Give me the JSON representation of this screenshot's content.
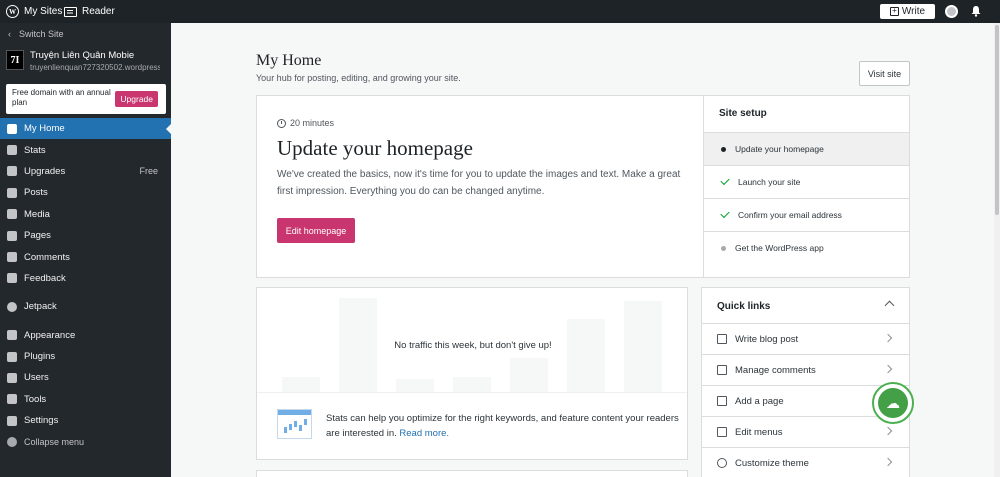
{
  "masterbar": {
    "my_sites": "My Sites",
    "reader": "Reader",
    "write": "Write"
  },
  "sidebar": {
    "switch_site": "Switch Site",
    "site_name": "Truyện Liên Quân Mobie",
    "site_url": "truyenlienquan727320502.wordpress.com",
    "site_icon_text": "7I",
    "upsell_text": "Free domain with an annual plan",
    "upsell_button": "Upgrade",
    "items": [
      {
        "label": "My Home",
        "icon": "home-icon"
      },
      {
        "label": "Stats",
        "icon": "stats-icon"
      },
      {
        "label": "Upgrades",
        "icon": "upgrades-icon",
        "badge": "Free"
      },
      {
        "label": "Posts",
        "icon": "posts-icon"
      },
      {
        "label": "Media",
        "icon": "media-icon"
      },
      {
        "label": "Pages",
        "icon": "pages-icon"
      },
      {
        "label": "Comments",
        "icon": "comments-icon"
      },
      {
        "label": "Feedback",
        "icon": "feedback-icon"
      },
      {
        "label": "Jetpack",
        "icon": "jetpack-icon"
      },
      {
        "label": "Appearance",
        "icon": "appearance-icon"
      },
      {
        "label": "Plugins",
        "icon": "plugins-icon"
      },
      {
        "label": "Users",
        "icon": "users-icon"
      },
      {
        "label": "Tools",
        "icon": "tools-icon"
      },
      {
        "label": "Settings",
        "icon": "settings-icon"
      }
    ],
    "collapse": "Collapse menu"
  },
  "main": {
    "title": "My Home",
    "subtitle": "Your hub for posting, editing, and growing your site.",
    "visit_site": "Visit site"
  },
  "hero": {
    "time": "20 minutes",
    "title": "Update your homepage",
    "text": "We've created the basics, now it's time for you to update the images and text. Make a great first impression. Everything you do can be changed anytime.",
    "button": "Edit homepage"
  },
  "setup": {
    "title": "Site setup",
    "items": [
      {
        "label": "Update your homepage",
        "state": "current"
      },
      {
        "label": "Launch your site",
        "state": "done"
      },
      {
        "label": "Confirm your email address",
        "state": "done"
      },
      {
        "label": "Get the WordPress app",
        "state": "todo"
      }
    ]
  },
  "stats": {
    "empty": "No traffic this week, but don't give up!",
    "text": "Stats can help you optimize for the right keywords, and feature content your readers are interested in.",
    "link": "Read more."
  },
  "quick_links": {
    "title": "Quick links",
    "items": [
      {
        "label": "Write blog post",
        "icon": "pencil-icon"
      },
      {
        "label": "Manage comments",
        "icon": "comment-icon"
      },
      {
        "label": "Add a page",
        "icon": "page-icon"
      },
      {
        "label": "Edit menus",
        "icon": "menu-icon"
      },
      {
        "label": "Customize theme",
        "icon": "palette-icon"
      }
    ]
  },
  "colors": {
    "accent": "#c9356e",
    "active": "#2271b1",
    "sidebar": "#23282d",
    "masterbar": "#1d2327"
  }
}
